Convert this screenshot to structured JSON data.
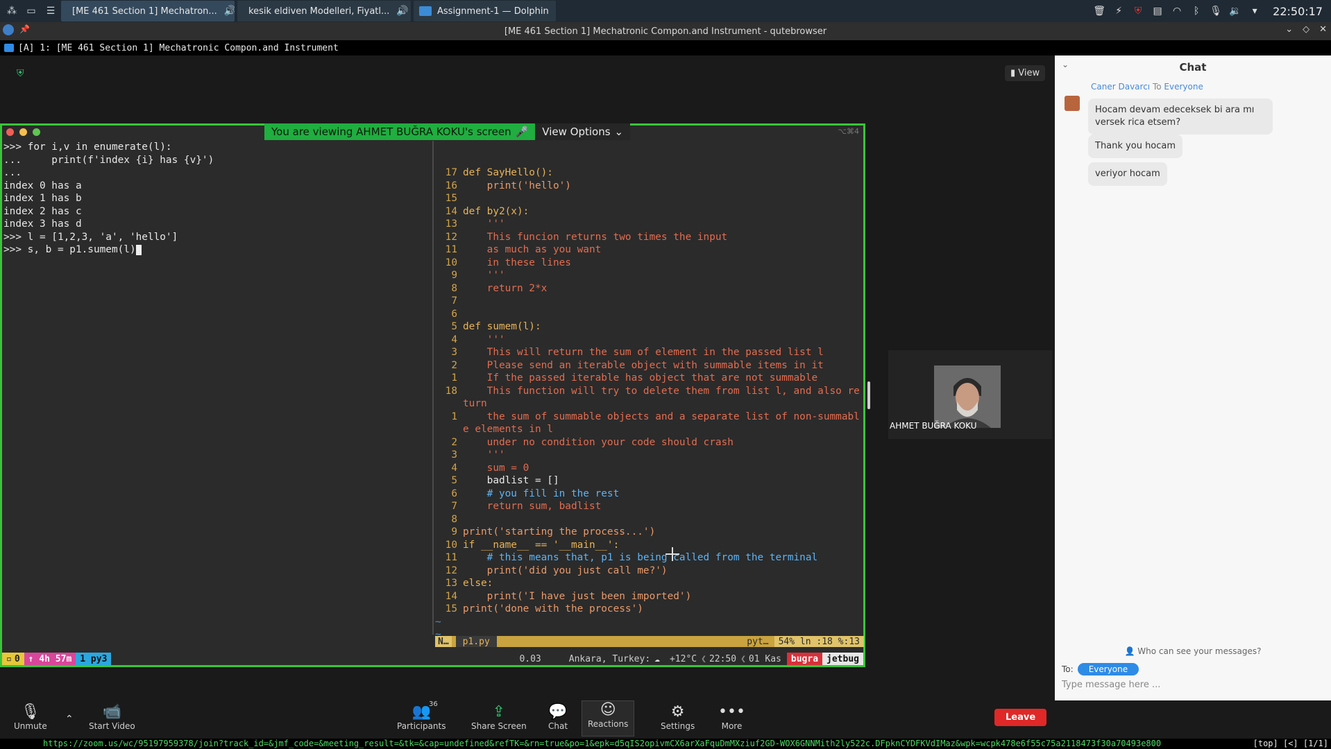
{
  "taskbar": {
    "tasks": [
      {
        "label": "[ME 461 Section 1] Mechatron..."
      },
      {
        "label": "kesik eldiven Modelleri, Fiyatl..."
      },
      {
        "label": "Assignment-1 — Dolphin"
      }
    ],
    "clock": "22:50:17"
  },
  "browser": {
    "window_title": "[ME 461 Section 1] Mechatronic Compon.and Instrument - qutebrowser",
    "tab_label": "[A] 1: [ME 461 Section 1] Mechatronic Compon.and Instrument",
    "status_url": "https://zoom.us/wc/95197959378/join?track_id=&jmf_code=&meeting_result=&tk=&cap=undefined&refTK=&rn=true&po=1&epk=d5qIS2opivmCX6arXaFquDmMXziuf2GD-WOX6GNNMith2ly522c.DFpknCYDFKVdIMaz&wpk=wcpk478e6f55c75a2118473f30a70493e800",
    "status_suffix": "[top] [<] [1/1]"
  },
  "meeting": {
    "view_label": "View",
    "banner_text": "You are viewing AHMET BUĞRA KOKU's screen",
    "view_options_label": "View Options",
    "window_key_hint": "⌥⌘4",
    "participant_name": "AHMET BUĞRA KOKU"
  },
  "terminal": {
    "lines": [
      ">>> for i,v in enumerate(l):",
      "...     print(f'index {i} has {v}')",
      "...",
      "index 0 has a",
      "index 1 has b",
      "index 2 has c",
      "index 3 has d",
      ">>> l = [1,2,3, 'a', 'hello']",
      ">>> s, b = p1.sumem(l)"
    ]
  },
  "vim": {
    "rows": [
      {
        "n": "17",
        "t": "def SayHello():",
        "c": "def"
      },
      {
        "n": "16",
        "t": "    print('hello')",
        "c": "str"
      },
      {
        "n": "15",
        "t": "",
        "c": "var"
      },
      {
        "n": "14",
        "t": "def by2(x):",
        "c": "def"
      },
      {
        "n": "13",
        "t": "    '''",
        "c": "doc"
      },
      {
        "n": "12",
        "t": "    This funcion returns two times the input",
        "c": "doc"
      },
      {
        "n": "11",
        "t": "    as much as you want",
        "c": "doc"
      },
      {
        "n": "10",
        "t": "    in these lines",
        "c": "doc"
      },
      {
        "n": "9",
        "t": "    '''",
        "c": "doc"
      },
      {
        "n": "8",
        "t": "    return 2*x",
        "c": "doc"
      },
      {
        "n": "7",
        "t": "",
        "c": "var"
      },
      {
        "n": "6",
        "t": "",
        "c": "var"
      },
      {
        "n": "5",
        "t": "def sumem(l):",
        "c": "def"
      },
      {
        "n": "4",
        "t": "    '''",
        "c": "doc"
      },
      {
        "n": "3",
        "t": "    This will return the sum of element in the passed list l",
        "c": "doc"
      },
      {
        "n": "2",
        "t": "    Please send an iterable object with summable items in it",
        "c": "doc"
      },
      {
        "n": "1",
        "t": "    If the passed iterable has object that are not summable",
        "c": "doc"
      },
      {
        "n": "18",
        "t": "    This function will try to delete them from list l, and also re",
        "c": "doc"
      },
      {
        "n": "",
        "t": "turn",
        "c": "doc"
      },
      {
        "n": "1",
        "t": "    the sum of summable objects and a separate list of non-summabl",
        "c": "doc"
      },
      {
        "n": "",
        "t": "e elements in l",
        "c": "doc"
      },
      {
        "n": "2",
        "t": "    under no condition your code should crash",
        "c": "doc"
      },
      {
        "n": "3",
        "t": "    '''",
        "c": "doc"
      },
      {
        "n": "4",
        "t": "    sum = 0",
        "c": "doc"
      },
      {
        "n": "5",
        "t": "    badlist = []",
        "c": "var"
      },
      {
        "n": "6",
        "t": "    # you fill in the rest",
        "c": "cmt"
      },
      {
        "n": "7",
        "t": "    return sum, badlist",
        "c": "doc"
      },
      {
        "n": "8",
        "t": "",
        "c": "var"
      },
      {
        "n": "9",
        "t": "print('starting the process...')",
        "c": "str"
      },
      {
        "n": "10",
        "t": "if __name__ == '__main__':",
        "c": "def"
      },
      {
        "n": "11",
        "t": "    # this means that, p1 is being called from the terminal",
        "c": "cmt"
      },
      {
        "n": "12",
        "t": "    print('did you just call me?')",
        "c": "str"
      },
      {
        "n": "13",
        "t": "else:",
        "c": "def"
      },
      {
        "n": "14",
        "t": "    print('I have just been imported')",
        "c": "str"
      },
      {
        "n": "15",
        "t": "print('done with the process')",
        "c": "str"
      },
      {
        "n": "~",
        "t": "",
        "c": "tilde"
      },
      {
        "n": "~",
        "t": "",
        "c": "tilde"
      },
      {
        "n": "~",
        "t": "",
        "c": "tilde"
      }
    ],
    "status_mode": "N…",
    "status_file": "p1.py",
    "status_filetype": "pyt…",
    "status_position": "54% ln :18 %:13"
  },
  "tmux": {
    "window": "0",
    "uptime": "↑ 4h 57m",
    "pane": "1 py3",
    "load": "0.03",
    "location": "Ankara, Turkey:",
    "weather": "+12°C",
    "time": "22:50",
    "date": "01 Kas",
    "user": "bugra",
    "host": "jetbug"
  },
  "toolbar": {
    "unmute": "Unmute",
    "start_video": "Start Video",
    "participants": "Participants",
    "participants_count": "36",
    "share_screen": "Share Screen",
    "chat": "Chat",
    "reactions": "Reactions",
    "settings": "Settings",
    "more": "More",
    "leave": "Leave"
  },
  "chat": {
    "title": "Chat",
    "sender": "Caner Davarcı",
    "to_word": "To",
    "recipient": "Everyone",
    "messages": [
      "Hocam devam edeceksek bi ara mı versek rica etsem?",
      "Thank you hocam",
      "veriyor hocam"
    ],
    "who_can_see": "Who can see your messages?",
    "to_label": "To:",
    "to_target": "Everyone",
    "input_placeholder": "Type message here ..."
  }
}
